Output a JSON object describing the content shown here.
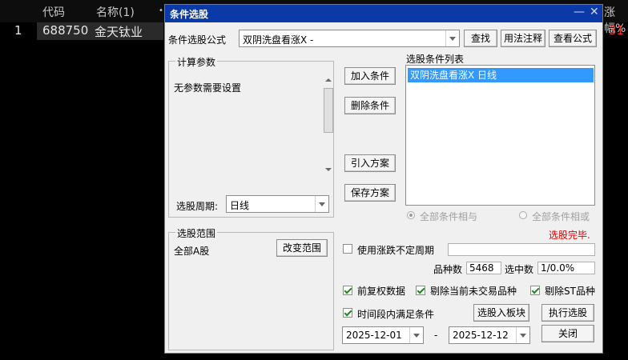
{
  "background_table": {
    "headers": [
      "代码",
      "名称(1)",
      "•",
      "涨幅%"
    ],
    "row": {
      "index": "1",
      "code": "688750",
      "name": "金天钛业",
      "value": "31"
    }
  },
  "dialog": {
    "title": "条件选股",
    "formula_label": "条件选股公式",
    "formula_value": "双阴洗盘看涨X  -",
    "find_btn": "查找",
    "usage_btn": "用法注释",
    "view_formula_btn": "查看公式",
    "params_group": "计算参数",
    "params_text": "无参数需要设置",
    "period_label": "选股周期:",
    "period_value": "日线",
    "add_btn": "加入条件",
    "remove_btn": "删除条件",
    "import_btn": "引入方案",
    "save_btn": "保存方案",
    "list_label": "选股条件列表",
    "list_items": [
      "双阴洗盘看涨X  日线"
    ],
    "radio_and": "全部条件相与",
    "radio_or": "全部条件相或",
    "status": "选股完毕.",
    "range_group": "选股范围",
    "range_value": "全部A股",
    "change_range_btn": "改变范围",
    "uncertain_period": "使用涨跌不定周期",
    "count_label": "品种数",
    "count_value": "5468",
    "selected_label": "选中数",
    "selected_value": "1/0.0%",
    "adj_data": "前复权数据",
    "exclude_untraded": "剔除当前未交易品种",
    "exclude_st": "剔除ST品种",
    "time_range": "时间段内满足条件",
    "to_block_btn": "选股入板块",
    "execute_btn": "执行选股",
    "date_start": "2025-12-01",
    "date_sep": "-",
    "date_end": "2025-12-12",
    "close_btn": "关闭",
    "minimize_icon": "—",
    "close_icon": "✕",
    "checks": {
      "uncertain_period": false,
      "adj_data": true,
      "exclude_untraded": true,
      "exclude_st": true,
      "time_range": true
    },
    "colors": {
      "title_bg": "#0b3aa8",
      "selection": "#3399ff",
      "status": "#e00000"
    }
  }
}
